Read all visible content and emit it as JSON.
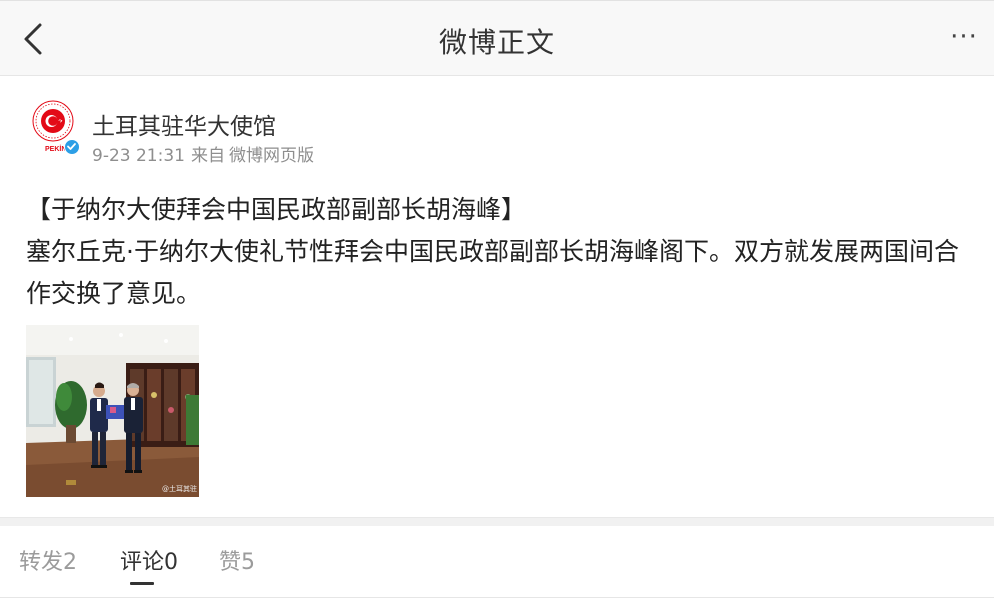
{
  "header": {
    "title": "微博正文",
    "back_icon": "back-chevron-icon",
    "more_label": "···"
  },
  "post": {
    "author": "土耳其驻华大使馆",
    "avatar_caption": "PEKİN",
    "verified_icon": "verified-check-icon",
    "timestamp": "9-23 21:31",
    "source_prefix": "来自",
    "source": "微博网页版",
    "content_title": "【于纳尔大使拜会中国民政部副部长胡海峰】",
    "content_body": "塞尔丘克·于纳尔大使礼节性拜会中国民政部副部长胡海峰阁下。双方就发展两国间合作交换了意见。",
    "image_watermark": "@土耳其驻"
  },
  "tabs": [
    {
      "label": "转发2",
      "active": false
    },
    {
      "label": "评论0",
      "active": true
    },
    {
      "label": "赞5",
      "active": false
    }
  ],
  "colors": {
    "header_bg": "#f8f8f8",
    "verified_blue": "#2d9fe6",
    "muted_text": "#8e8e8e",
    "turkey_red": "#e30a17"
  }
}
